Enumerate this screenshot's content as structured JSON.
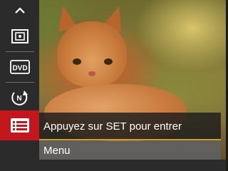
{
  "sidebar": {
    "items": [
      {
        "icon": "chevron-up-icon"
      },
      {
        "icon": "metering-icon"
      },
      {
        "icon": "dvd-icon",
        "label": "DVD"
      },
      {
        "icon": "flash-off-icon",
        "label": "N"
      },
      {
        "icon": "menu-list-icon",
        "active": true
      }
    ],
    "active_color": "#c4171d"
  },
  "popup": {
    "title": "Appuyez sur SET pour entrer",
    "option": "Menu",
    "underline_color": "#c69b3a"
  }
}
